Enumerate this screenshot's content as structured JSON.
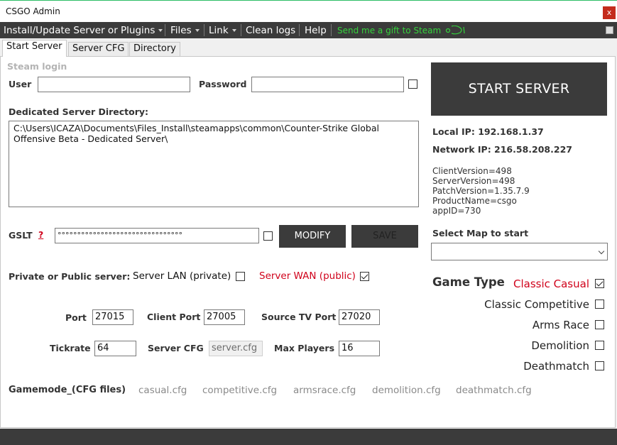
{
  "window": {
    "title": "CSGO Admin",
    "close_label": "x"
  },
  "menu": {
    "items": [
      "Install/Update Server or Plugins",
      "Files",
      "Link",
      "Clean logs",
      "Help"
    ],
    "gift": "Send me a gift to Steam"
  },
  "tabs": [
    "Start Server",
    "Server CFG",
    "Directory"
  ],
  "steam_login": {
    "heading": "Steam login",
    "user_label": "User",
    "user_value": "",
    "password_label": "Password",
    "password_value": ""
  },
  "directory": {
    "label": "Dedicated Server Directory:",
    "value": "C:\\Users\\ICAZA\\Documents\\Files_Install\\steamapps\\common\\Counter-Strike Global Offensive Beta - Dedicated Server\\"
  },
  "gslt": {
    "label": "GSLT",
    "help": "?",
    "value": "°°°°°°°°°°°°°°°°°°°°°°°°°°°°°°°°",
    "modify_label": "MODIFY",
    "save_label": "SAVE"
  },
  "server_type": {
    "label": "Private or Public server:",
    "lan_label": "Server LAN (private)",
    "wan_label": "Server WAN (public)",
    "lan_checked": false,
    "wan_checked": true
  },
  "ports": {
    "port_label": "Port",
    "port_value": "27015",
    "client_label": "Client Port",
    "client_value": "27005",
    "tv_label": "Source TV Port",
    "tv_value": "27020"
  },
  "settings": {
    "tickrate_label": "Tickrate",
    "tickrate_value": "64",
    "cfg_label": "Server CFG",
    "cfg_value": "server.cfg",
    "players_label": "Max Players",
    "players_value": "16"
  },
  "gamemode": {
    "label": "Gamemode_(CFG files)",
    "files": [
      "casual.cfg",
      "competitive.cfg",
      "armsrace.cfg",
      "demolition.cfg",
      "deathmatch.cfg"
    ]
  },
  "start_server_label": "START SERVER",
  "network": {
    "local_ip": "Local IP: 192.168.1.37",
    "network_ip": "Network IP: 216.58.208.227",
    "version_lines": [
      "ClientVersion=498",
      "ServerVersion=498",
      "PatchVersion=1.35.7.9",
      "ProductName=csgo",
      "appID=730"
    ]
  },
  "map": {
    "label": "Select Map to start",
    "value": ""
  },
  "game_type": {
    "label": "Game Type",
    "options": [
      {
        "name": "Classic Casual",
        "checked": true
      },
      {
        "name": "Classic Competitive",
        "checked": false
      },
      {
        "name": "Arms Race",
        "checked": false
      },
      {
        "name": "Demolition",
        "checked": false
      },
      {
        "name": "Deathmatch",
        "checked": false
      }
    ]
  },
  "colors": {
    "accent_red": "#d0021b",
    "dark": "#3b3b3b",
    "gift_green": "#34d33c"
  }
}
